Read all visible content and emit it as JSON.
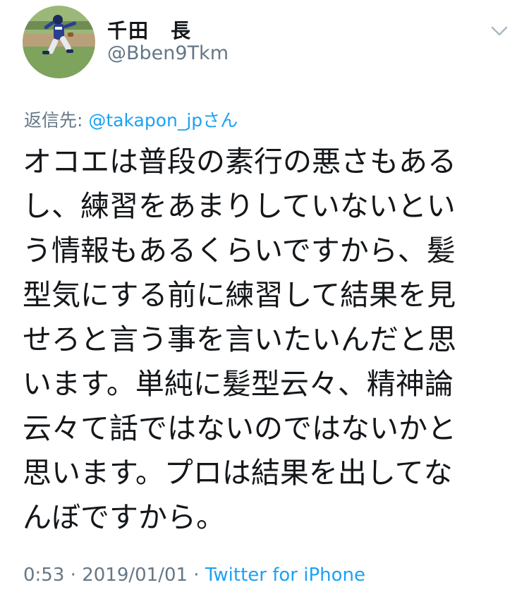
{
  "author": {
    "display_name": "千田　長",
    "handle": "@Bben9Tkm"
  },
  "reply": {
    "prefix": "返信先: ",
    "mention": "@takapon_jpさん"
  },
  "tweet": {
    "lines": [
      "オコエは普段の素行の悪さもある",
      "し、練習をあまりしていないとい",
      "う情報もあるくらいですから、髪",
      "型気にする前に練習して結果を見",
      "せろと言う事を言いたいんだと思",
      "います。単純に髪型云々、精神論",
      "云々て話ではないのではないかと",
      "思います。プロは結果を出してな",
      "んぼですから。"
    ]
  },
  "meta": {
    "time": "0:53",
    "separator1": " · ",
    "date": "2019/01/01",
    "separator2": " · ",
    "source": "Twitter for iPhone"
  },
  "icons": {
    "menu": "chevron-down-icon",
    "avatar": "baseball-pitcher-photo"
  },
  "colors": {
    "text": "#14171a",
    "secondary": "#657786",
    "link": "#1da1f2"
  }
}
